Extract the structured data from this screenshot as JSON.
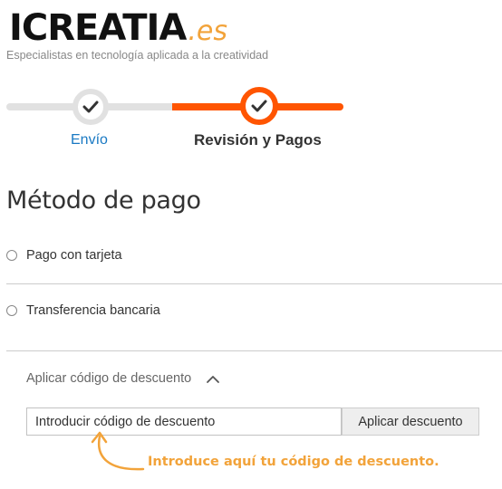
{
  "brand": {
    "logo_main": "ICREATIA",
    "logo_ext": ".es",
    "tagline": "Especialistas en tecnología aplicada a la creatividad",
    "accent_color": "#ff5501",
    "logo_accent_color": "#f2a33a"
  },
  "progress": {
    "steps": [
      {
        "label": "Envío",
        "icon": "check-icon",
        "status": "completed"
      },
      {
        "label": "Revisión y Pagos",
        "icon": "check-icon",
        "status": "active"
      }
    ]
  },
  "payment": {
    "title": "Método de pago",
    "options": [
      {
        "label": "Pago con tarjeta",
        "selected": false
      },
      {
        "label": "Transferencia bancaria",
        "selected": false
      }
    ]
  },
  "discount": {
    "toggle_label": "Aplicar código de descuento",
    "toggle_icon": "chevron-up-icon",
    "input_placeholder": "Introducir código de descuento",
    "input_value": "",
    "button_label": "Aplicar descuento"
  },
  "annotation": {
    "text": "Introduce aquí tu código de descuento.",
    "icon": "curved-arrow-icon"
  }
}
